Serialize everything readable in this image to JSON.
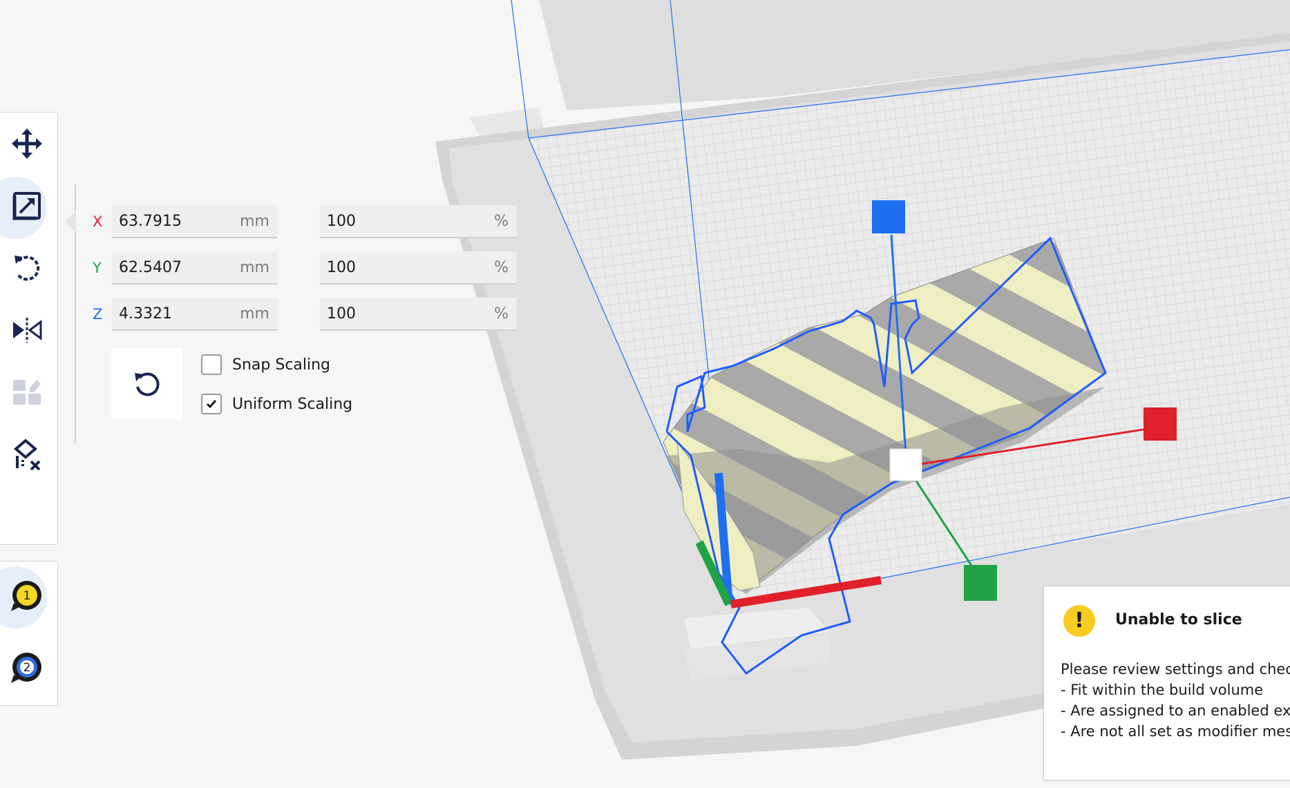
{
  "scale_panel": {
    "x": {
      "label": "X",
      "mm_value": "63.7915",
      "mm_unit": "mm",
      "percent_value": "100",
      "percent_unit": "%"
    },
    "y": {
      "label": "Y",
      "mm_value": "62.5407",
      "mm_unit": "mm",
      "percent_value": "100",
      "percent_unit": "%"
    },
    "z": {
      "label": "Z",
      "mm_value": "4.3321",
      "mm_unit": "mm",
      "percent_value": "100",
      "percent_unit": "%"
    },
    "snap_scaling": {
      "label": "Snap Scaling",
      "checked": false
    },
    "uniform_scaling": {
      "label": "Uniform Scaling",
      "checked": true
    }
  },
  "toolbar": {
    "tools": [
      {
        "name": "move",
        "icon": "move-icon"
      },
      {
        "name": "scale",
        "icon": "scale-icon",
        "active": true
      },
      {
        "name": "rotate",
        "icon": "rotate-icon"
      },
      {
        "name": "mirror",
        "icon": "mirror-icon"
      },
      {
        "name": "per-model-settings",
        "icon": "per-model-settings-icon",
        "disabled": true
      },
      {
        "name": "support-blocker",
        "icon": "support-blocker-icon"
      }
    ],
    "extruders": [
      {
        "number": "1",
        "color": "#f5d72a",
        "active": true
      },
      {
        "number": "2",
        "color": "#2c6fe0"
      }
    ]
  },
  "notification": {
    "title": "Unable to slice",
    "icon": "warning-icon",
    "lines": [
      "Please review settings and check",
      "- Fit within the build volume",
      "- Are assigned to an enabled ext",
      "- Are not all set as modifier mesh"
    ]
  },
  "colors": {
    "axis_x": "#e0202a",
    "axis_y": "#1fa346",
    "axis_z": "#1f6ff0",
    "accent": "#1f5cff",
    "model_yellow": "#efeec2",
    "model_gray": "#a8a8a8"
  }
}
